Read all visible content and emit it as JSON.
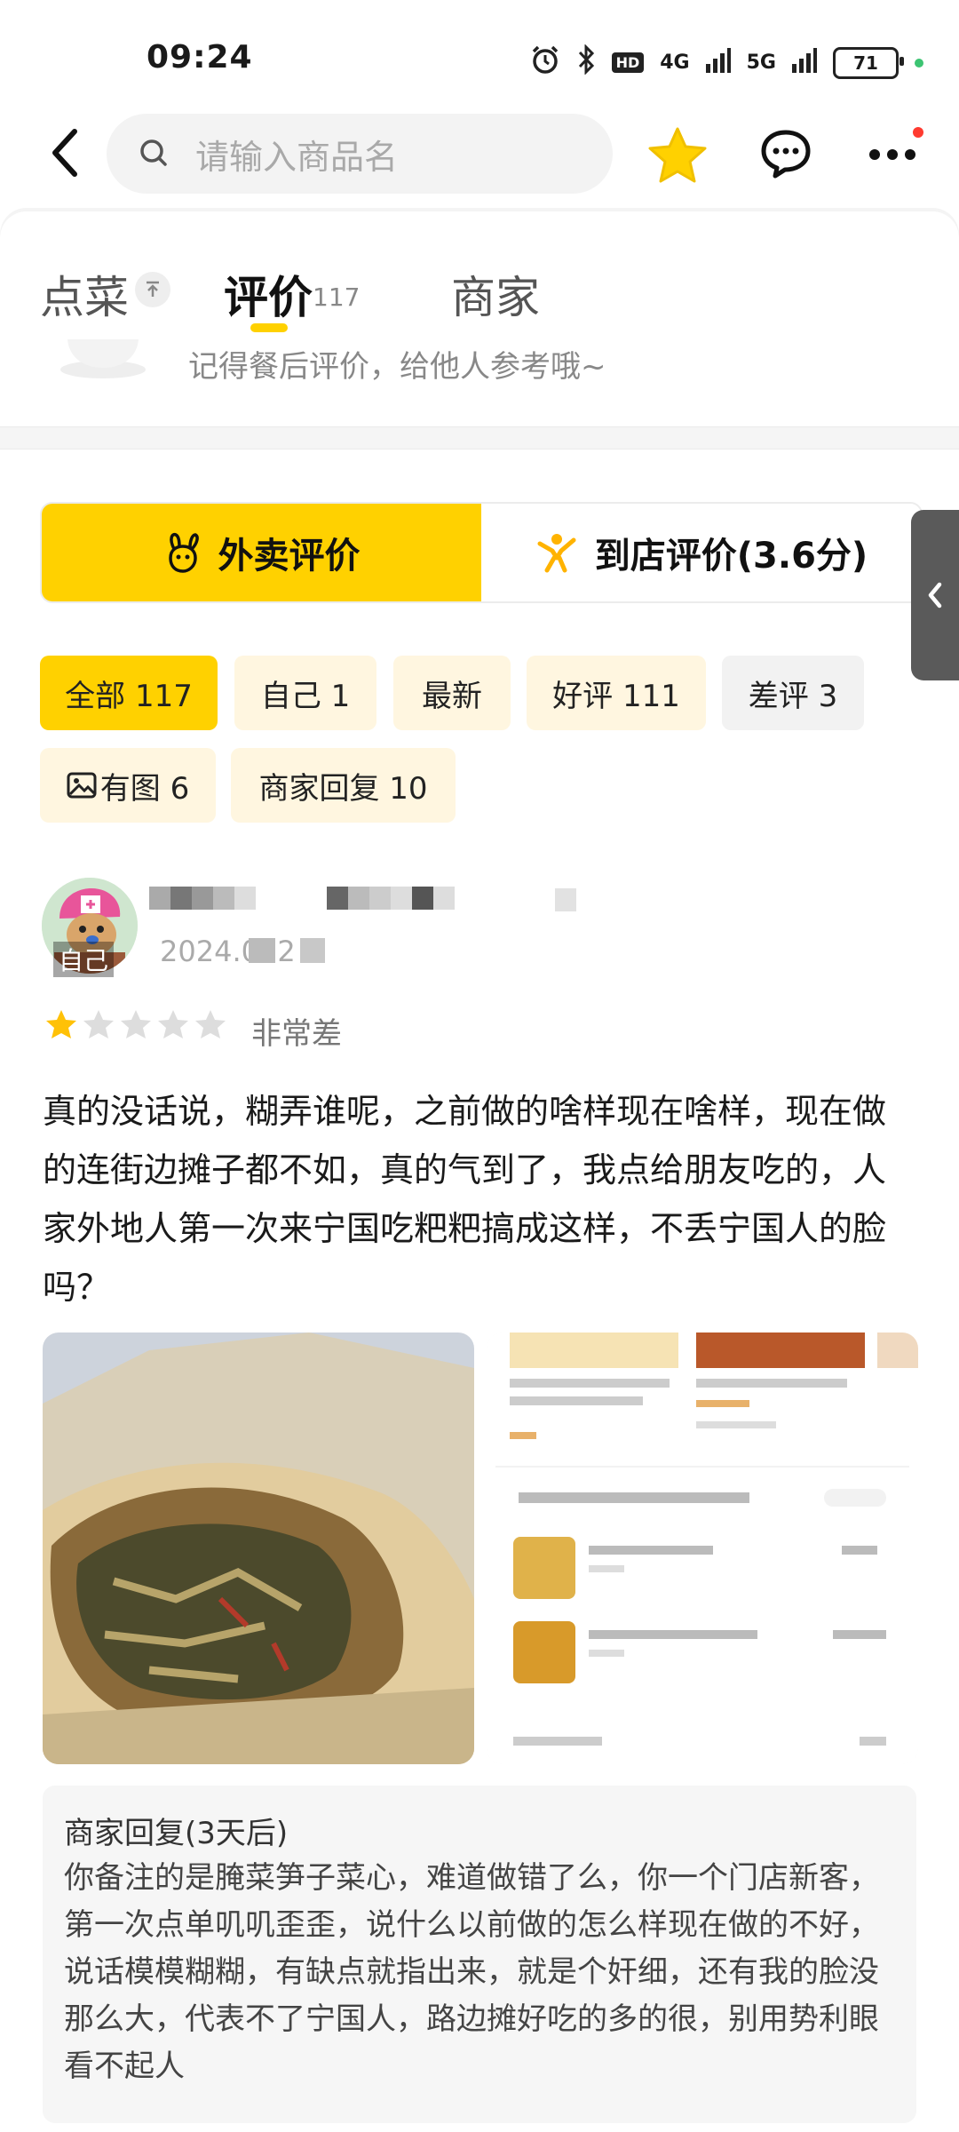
{
  "status_bar": {
    "time": "09:24",
    "battery": "71",
    "hd": "HD",
    "net1": "4G",
    "net2": "5G"
  },
  "nav": {
    "search_placeholder": "请输入商品名"
  },
  "tabs": {
    "order_label": "点菜",
    "review_label": "评价",
    "review_count": "117",
    "merchant_label": "商家",
    "hint": "记得餐后评价，给他人参考哦~"
  },
  "toggle": {
    "delivery_label": "外卖评价",
    "instore_label": "到店评价(3.6分)"
  },
  "filters": [
    {
      "label": "全部 117"
    },
    {
      "label": "自己 1"
    },
    {
      "label": "最新"
    },
    {
      "label": "好评 111"
    },
    {
      "label": "差评 3"
    },
    {
      "label": "有图 6"
    },
    {
      "label": "商家回复 10"
    }
  ],
  "review": {
    "self_tag": "自己",
    "date": "2024.0 .2",
    "rating": 1,
    "rating_max": 5,
    "rating_text": "非常差",
    "body": "真的没话说，糊弄谁呢，之前做的啥样现在啥样，现在做的连街边摊子都不如，真的气到了，我点给朋友吃的，人家外地人第一次来宁国吃粑粑搞成这样，不丢宁国人的脸吗？",
    "reply_title": "商家回复(3天后)",
    "reply_body": "你备注的是腌菜笋子菜心，难道做错了么，你一个门店新客，第一次点单叽叽歪歪，说什么以前做的怎么样现在做的不好，说话模模糊糊，有缺点就指出来，就是个奸细，还有我的脸没那么大，代表不了宁国人，路边摊好吃的多的很，别用势利眼看不起人"
  },
  "colors": {
    "accent": "#ffd100",
    "chip_warm": "#fff6e0",
    "star_filled": "#ffc107",
    "star_empty": "#dddddd"
  }
}
